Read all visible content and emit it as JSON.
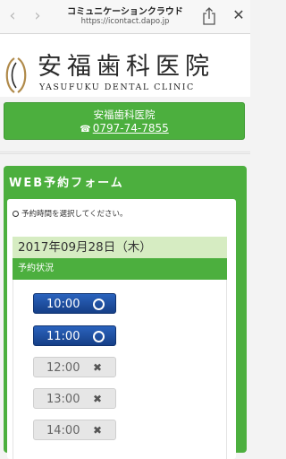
{
  "browser": {
    "back_icon": "‹",
    "forward_icon": "›",
    "title": "コミュニケーションクラウド",
    "url": "https://icontact.dapo.jp",
    "close_icon": "✕"
  },
  "clinic": {
    "name": "安福歯科医院",
    "name_en": "YASUFUKU DENTAL CLINIC"
  },
  "contact": {
    "name": "安福歯科医院",
    "phone_icon": "☎",
    "phone": "0797-74-7855"
  },
  "form": {
    "title": "WEB予約フォーム",
    "instruction": "予約時間を選択してください。",
    "date": "2017年09月28日（木）",
    "status_label": "予約状況",
    "slots": [
      {
        "time": "10:00",
        "available": true
      },
      {
        "time": "11:00",
        "available": true
      },
      {
        "time": "12:00",
        "available": false
      },
      {
        "time": "13:00",
        "available": false
      },
      {
        "time": "14:00",
        "available": false
      }
    ],
    "closed_mark": "✖"
  },
  "colors": {
    "green": "#4caf3e",
    "light_green": "#d6ecc2",
    "slot_blue": "#1d4fa3",
    "slot_gray": "#e6e6e6"
  }
}
